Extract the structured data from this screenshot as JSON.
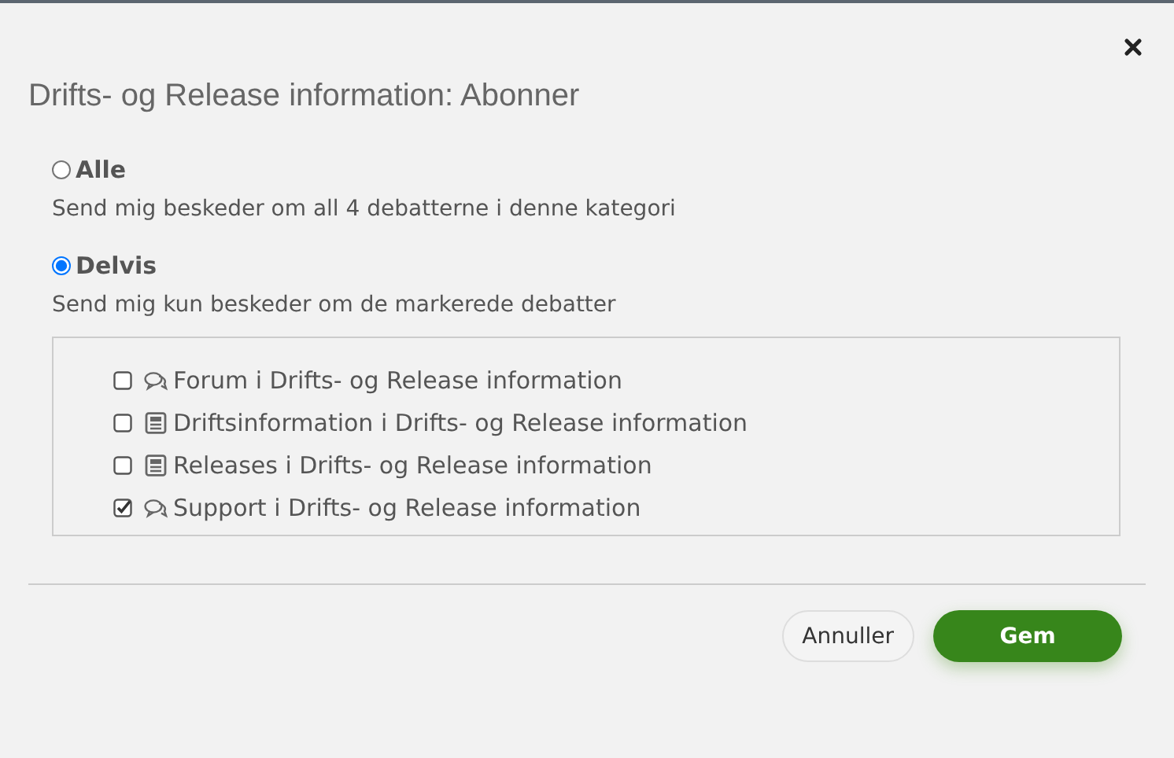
{
  "dialog": {
    "title": "Drifts- og Release information: Abonner"
  },
  "options": [
    {
      "label": "Alle",
      "description": "Send mig beskeder om all 4 debatterne i denne kategori",
      "selected": false
    },
    {
      "label": "Delvis",
      "description": "Send mig kun beskeder om de markerede debatter",
      "selected": true
    }
  ],
  "debates": [
    {
      "kind": "forum",
      "label": "Forum i Drifts- og Release information",
      "checked": false
    },
    {
      "kind": "document",
      "label": "Driftsinformation i Drifts- og Release information",
      "checked": false
    },
    {
      "kind": "document",
      "label": "Releases i Drifts- og Release information",
      "checked": false
    },
    {
      "kind": "forum",
      "label": "Support i Drifts- og Release information",
      "checked": true
    }
  ],
  "buttons": [
    {
      "kind": "secondary",
      "label": "Annuller"
    },
    {
      "kind": "primary",
      "label": "Gem"
    }
  ]
}
